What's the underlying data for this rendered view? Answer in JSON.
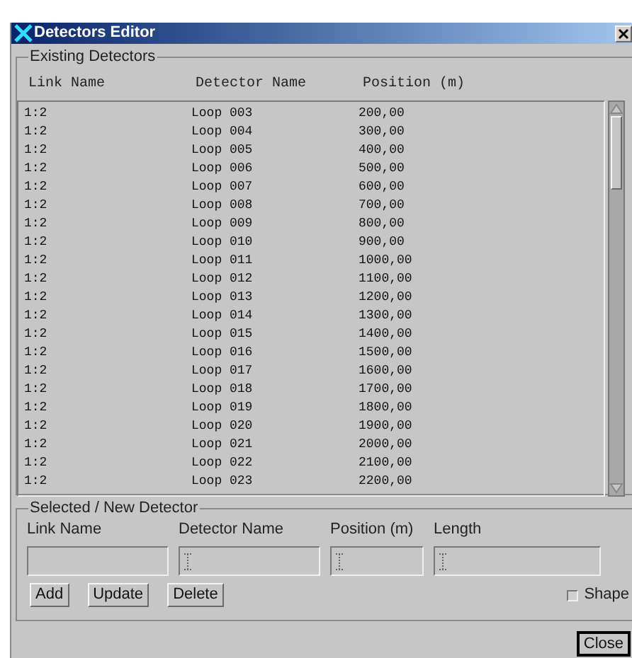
{
  "window": {
    "title": "Detectors Editor"
  },
  "existing": {
    "title": "Existing Detectors",
    "columns": [
      "Link Name",
      "Detector Name",
      "Position (m)"
    ],
    "rows": [
      [
        "1:2",
        "Loop 003",
        "200,00"
      ],
      [
        "1:2",
        "Loop 004",
        "300,00"
      ],
      [
        "1:2",
        "Loop 005",
        "400,00"
      ],
      [
        "1:2",
        "Loop 006",
        "500,00"
      ],
      [
        "1:2",
        "Loop 007",
        "600,00"
      ],
      [
        "1:2",
        "Loop 008",
        "700,00"
      ],
      [
        "1:2",
        "Loop 009",
        "800,00"
      ],
      [
        "1:2",
        "Loop 010",
        "900,00"
      ],
      [
        "1:2",
        "Loop 011",
        "1000,00"
      ],
      [
        "1:2",
        "Loop 012",
        "1100,00"
      ],
      [
        "1:2",
        "Loop 013",
        "1200,00"
      ],
      [
        "1:2",
        "Loop 014",
        "1300,00"
      ],
      [
        "1:2",
        "Loop 015",
        "1400,00"
      ],
      [
        "1:2",
        "Loop 016",
        "1500,00"
      ],
      [
        "1:2",
        "Loop 017",
        "1600,00"
      ],
      [
        "1:2",
        "Loop 018",
        "1700,00"
      ],
      [
        "1:2",
        "Loop 019",
        "1800,00"
      ],
      [
        "1:2",
        "Loop 020",
        "1900,00"
      ],
      [
        "1:2",
        "Loop 021",
        "2000,00"
      ],
      [
        "1:2",
        "Loop 022",
        "2100,00"
      ],
      [
        "1:2",
        "Loop 023",
        "2200,00"
      ]
    ]
  },
  "editor": {
    "title": "Selected / New Detector",
    "fields": [
      {
        "label": "Link Name",
        "cursor": false
      },
      {
        "label": "Detector Name",
        "cursor": true
      },
      {
        "label": "Position (m)",
        "cursor": true
      },
      {
        "label": "Length",
        "cursor": true
      }
    ],
    "buttons": [
      "Add",
      "Update",
      "Delete"
    ],
    "shape": {
      "label": "Shape",
      "checked": false
    }
  },
  "close": "Close"
}
